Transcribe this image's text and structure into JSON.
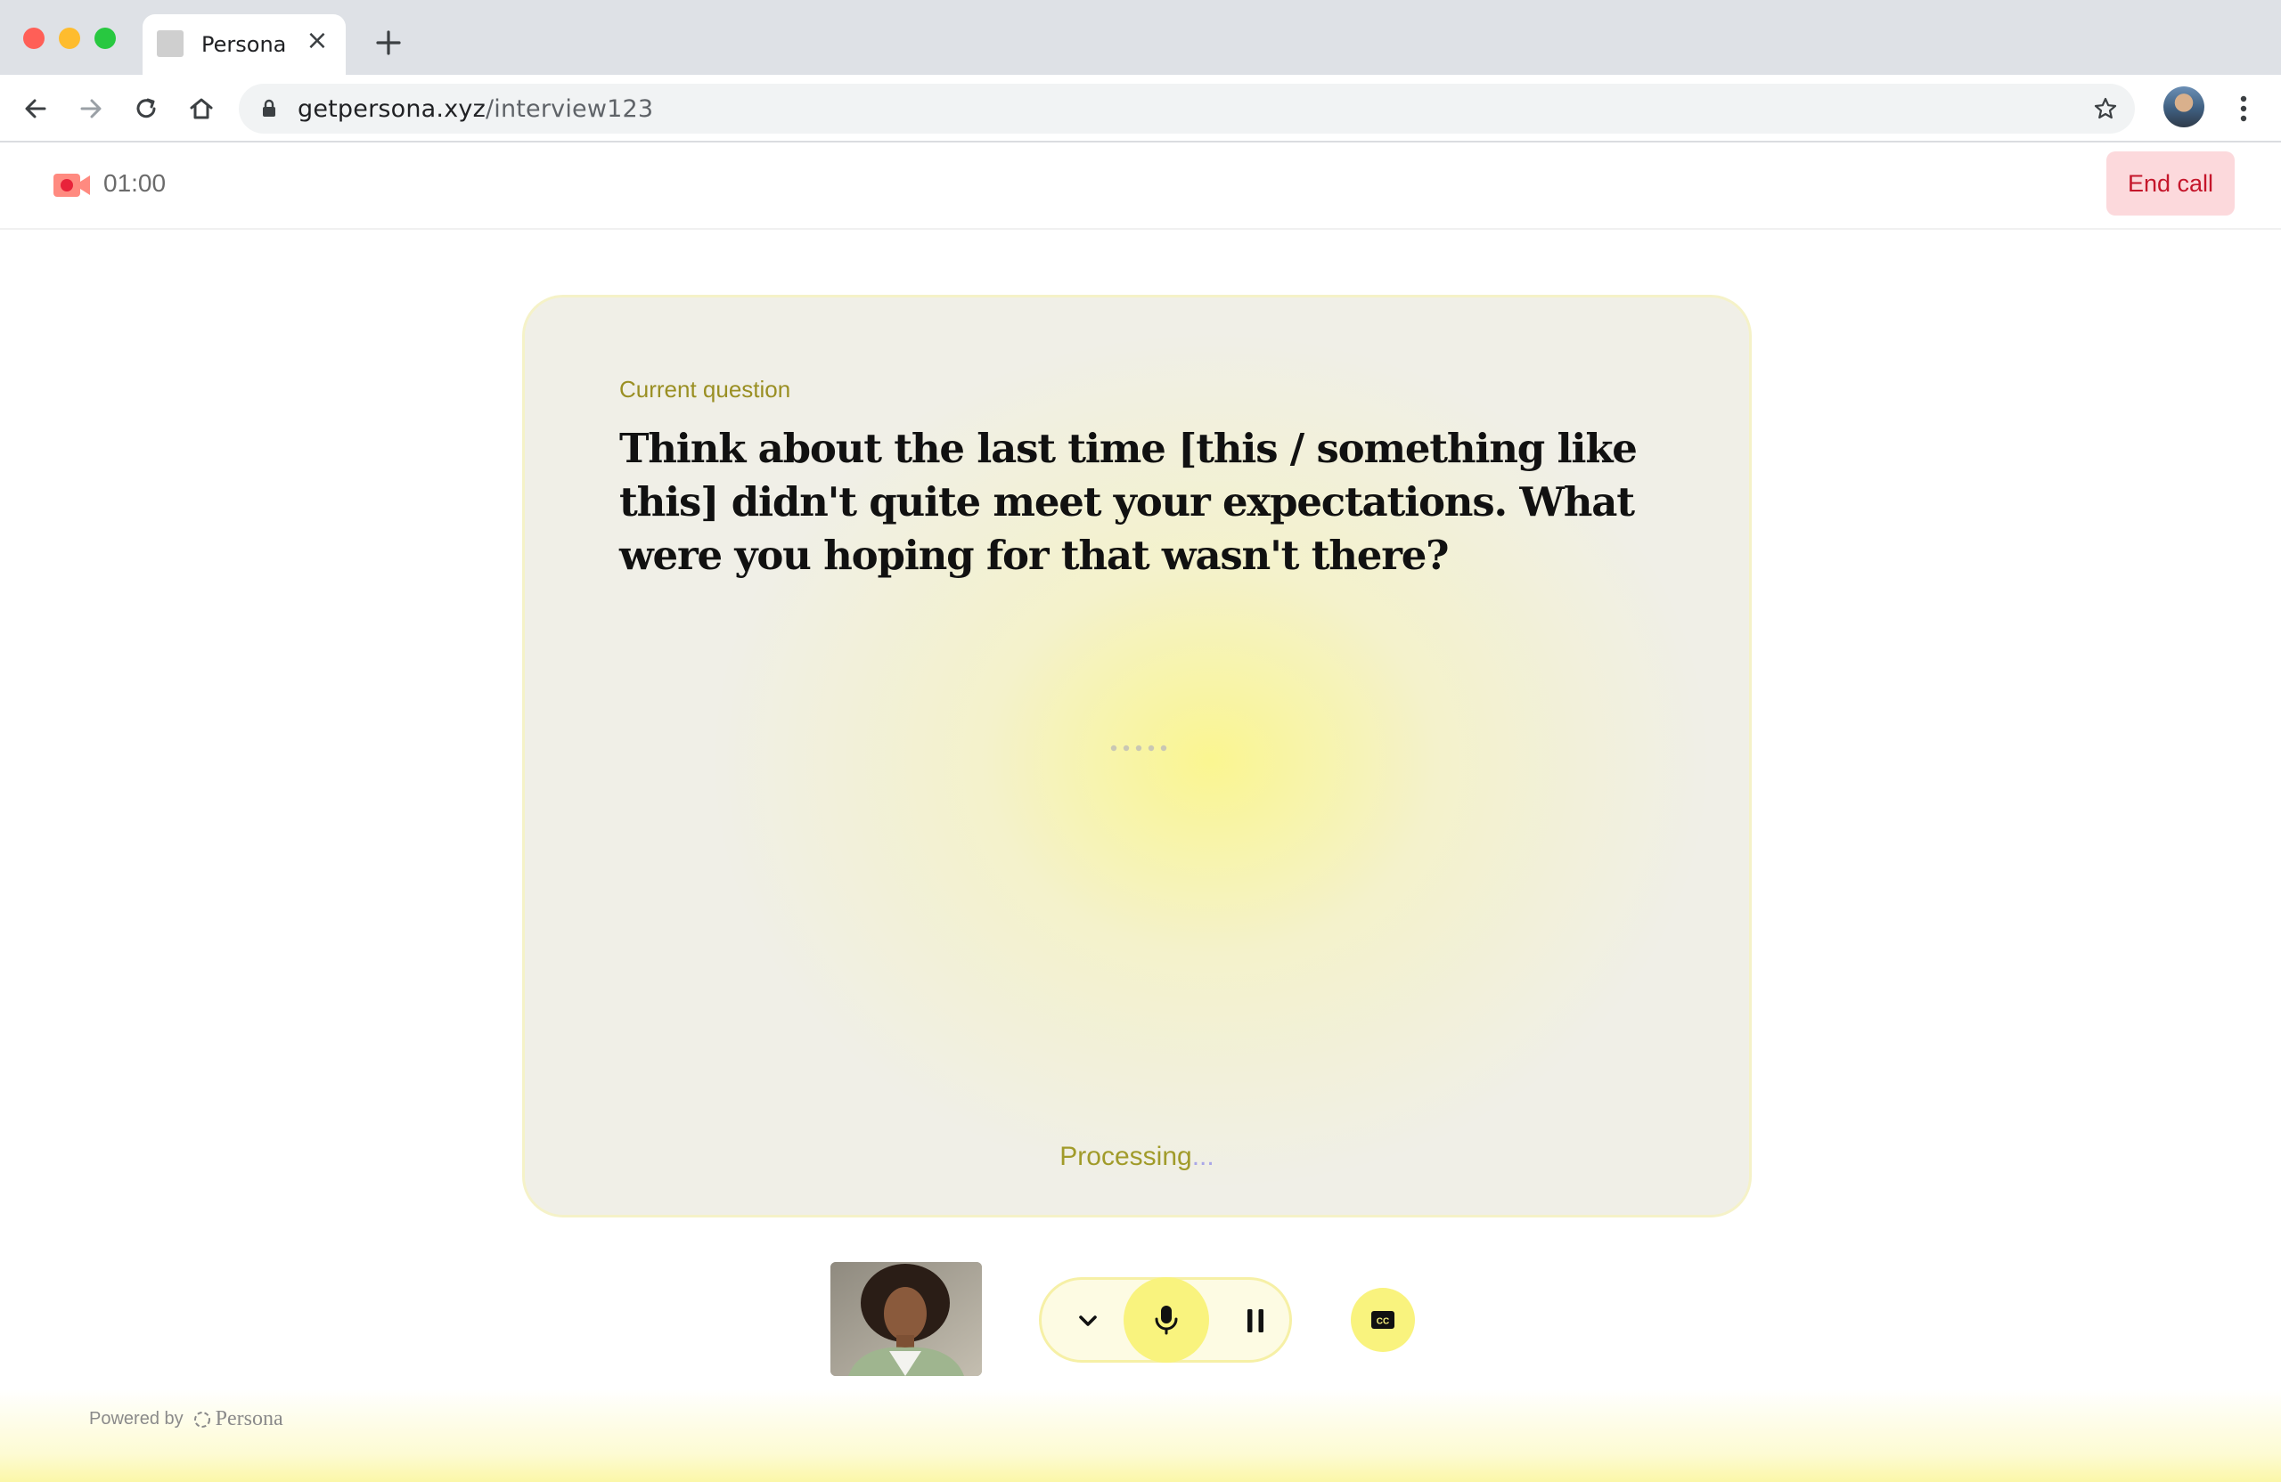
{
  "browser": {
    "tab_title": "Persona",
    "url_domain": "getpersona.xyz",
    "url_path": "/interview123"
  },
  "header": {
    "timer": "01:00",
    "end_call_label": "End call"
  },
  "card": {
    "label": "Current question",
    "question": "Think about the last time [this / something like this] didn't quite meet your expectations. What were you hoping for that wasn't there?",
    "status_main": "Processing",
    "status_tail": "..."
  },
  "footer": {
    "powered_by": "Powered by",
    "brand": "Persona"
  },
  "icons": {
    "record": "video-camera-icon",
    "mic": "microphone-icon",
    "pause": "pause-icon",
    "captions": "closed-captions-icon",
    "chevron": "chevron-down-icon"
  },
  "colors": {
    "accent_yellow": "#f9f37e",
    "end_call_bg": "#fcd9dc",
    "end_call_text": "#c5162b",
    "label_olive": "#9a8f23"
  }
}
